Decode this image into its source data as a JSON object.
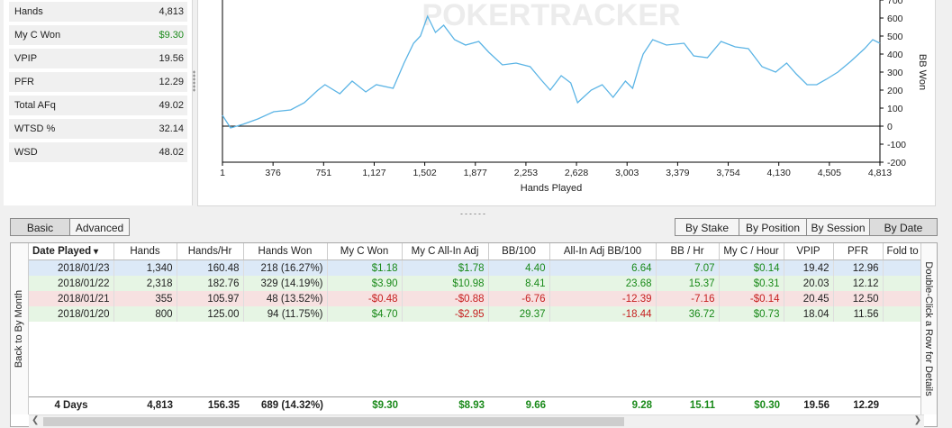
{
  "stats": [
    {
      "label": "Hands",
      "value": "4,813",
      "color": ""
    },
    {
      "label": "My C Won",
      "value": "$9.30",
      "color": "#1a8a1a"
    },
    {
      "label": "VPIP",
      "value": "19.56",
      "color": ""
    },
    {
      "label": "PFR",
      "value": "12.29",
      "color": ""
    },
    {
      "label": "Total AFq",
      "value": "49.02",
      "color": ""
    },
    {
      "label": "WTSD %",
      "value": "32.14",
      "color": ""
    },
    {
      "label": "WSD",
      "value": "48.02",
      "color": ""
    }
  ],
  "chart_data": {
    "type": "line",
    "watermark": "POKERTRACKER",
    "xlabel": "Hands Played",
    "ylabel": "BB Won",
    "x_ticks": [
      "1",
      "376",
      "751",
      "1,127",
      "1,502",
      "1,877",
      "2,253",
      "2,628",
      "3,003",
      "3,379",
      "3,754",
      "4,130",
      "4,505",
      "4,813"
    ],
    "y_ticks": [
      "-200",
      "-100",
      "0",
      "100",
      "200",
      "300",
      "400",
      "500",
      "600",
      "700"
    ],
    "xlim": [
      1,
      4813
    ],
    "ylim": [
      -200,
      700
    ],
    "line_color": "#5bb4e5",
    "series": [
      {
        "x": [
          1,
          60,
          150,
          260,
          376,
          500,
          600,
          700,
          751,
          860,
          950,
          1050,
          1127,
          1250,
          1330,
          1400,
          1450,
          1502,
          1560,
          1620,
          1700,
          1780,
          1877,
          1950,
          2050,
          2150,
          2253,
          2330,
          2400,
          2480,
          2550,
          2600,
          2628,
          2700,
          2780,
          2860,
          2950,
          3003,
          3050,
          3080,
          3150,
          3250,
          3379,
          3450,
          3550,
          3650,
          3754,
          3850,
          3950,
          4050,
          4130,
          4200,
          4280,
          4350,
          4420,
          4505,
          4600,
          4700,
          4760,
          4813
        ],
        "y": [
          60,
          -10,
          10,
          40,
          80,
          90,
          130,
          200,
          230,
          180,
          250,
          190,
          230,
          210,
          350,
          460,
          500,
          610,
          520,
          560,
          480,
          450,
          470,
          410,
          340,
          350,
          330,
          260,
          200,
          280,
          240,
          130,
          150,
          200,
          230,
          160,
          250,
          210,
          330,
          400,
          480,
          450,
          460,
          390,
          380,
          470,
          440,
          430,
          330,
          300,
          350,
          290,
          230,
          230,
          260,
          300,
          360,
          430,
          480,
          460
        ]
      }
    ]
  },
  "view_toggle": {
    "basic": "Basic",
    "advanced": "Advanced"
  },
  "group_tabs": [
    "By Stake",
    "By Position",
    "By Session",
    "By Date"
  ],
  "side_left": "Back to By Month",
  "side_right": "Double-Click a Row for Details",
  "table": {
    "columns": [
      "Date Played",
      "Hands",
      "Hands/Hr",
      "Hands Won",
      "My C Won",
      "My C All-In Adj",
      "BB/100",
      "All-In Adj BB/100",
      "BB / Hr",
      "My C / Hour",
      "VPIP",
      "PFR",
      "Fold to"
    ],
    "rows": [
      {
        "style": "blue",
        "cells": [
          "2018/01/23",
          "1,340",
          "160.48",
          "218 (16.27%)",
          "$1.18",
          "$1.78",
          "4.40",
          "6.64",
          "7.07",
          "$0.14",
          "19.42",
          "12.96",
          ""
        ]
      },
      {
        "style": "green",
        "cells": [
          "2018/01/22",
          "2,318",
          "182.76",
          "329 (14.19%)",
          "$3.90",
          "$10.98",
          "8.41",
          "23.68",
          "15.37",
          "$0.31",
          "20.03",
          "12.12",
          ""
        ]
      },
      {
        "style": "red",
        "cells": [
          "2018/01/21",
          "355",
          "105.97",
          "48 (13.52%)",
          "-$0.48",
          "-$0.88",
          "-6.76",
          "-12.39",
          "-7.16",
          "-$0.14",
          "20.45",
          "12.50",
          ""
        ]
      },
      {
        "style": "green",
        "cells": [
          "2018/01/20",
          "800",
          "125.00",
          "94 (11.75%)",
          "$4.70",
          "-$2.95",
          "29.37",
          "-18.44",
          "36.72",
          "$0.73",
          "18.04",
          "11.56",
          ""
        ]
      }
    ],
    "totals": [
      "4 Days",
      "4,813",
      "156.35",
      "689 (14.32%)",
      "$9.30",
      "$8.93",
      "9.66",
      "9.28",
      "15.11",
      "$0.30",
      "19.56",
      "12.29",
      ""
    ]
  }
}
